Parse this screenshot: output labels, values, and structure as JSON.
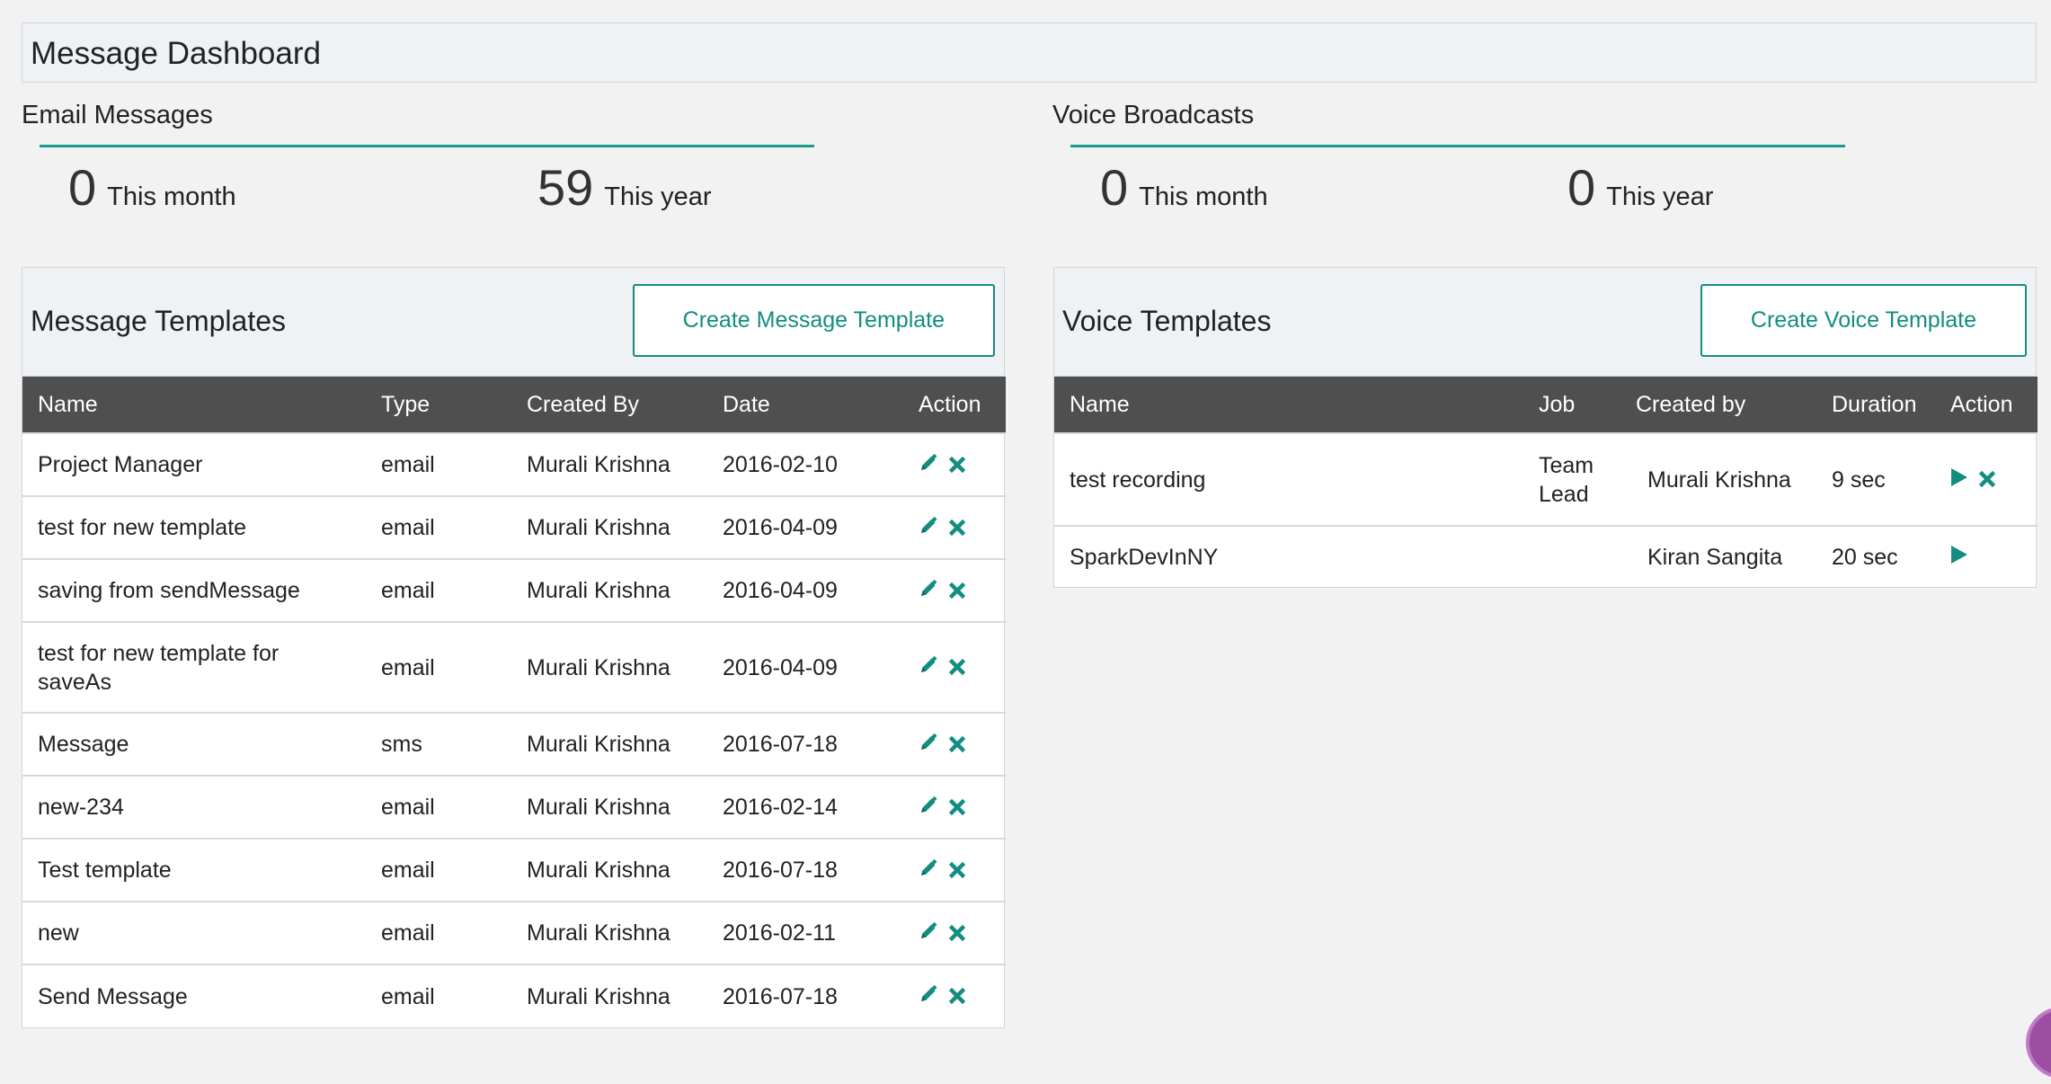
{
  "page": {
    "title": "Message Dashboard"
  },
  "email_stats": {
    "title": "Email Messages",
    "month": {
      "value": "0",
      "label": "This month"
    },
    "year": {
      "value": "59",
      "label": "This year"
    }
  },
  "voice_stats": {
    "title": "Voice Broadcasts",
    "month": {
      "value": "0",
      "label": "This month"
    },
    "year": {
      "value": "0",
      "label": "This year"
    }
  },
  "message_templates": {
    "title": "Message Templates",
    "create_label": "Create Message Template",
    "columns": [
      "Name",
      "Type",
      "Created By",
      "Date",
      "Action"
    ],
    "rows": [
      {
        "name": "Project Manager",
        "type": "email",
        "created_by": "Murali Krishna",
        "date": "2016-02-10"
      },
      {
        "name": "test for new template",
        "type": "email",
        "created_by": "Murali Krishna",
        "date": "2016-04-09"
      },
      {
        "name": "saving from sendMessage",
        "type": "email",
        "created_by": "Murali Krishna",
        "date": "2016-04-09"
      },
      {
        "name": "test for new template for saveAs",
        "type": "email",
        "created_by": "Murali Krishna",
        "date": "2016-04-09"
      },
      {
        "name": "Message",
        "type": "sms",
        "created_by": "Murali Krishna",
        "date": "2016-07-18"
      },
      {
        "name": "new-234",
        "type": "email",
        "created_by": "Murali Krishna",
        "date": "2016-02-14"
      },
      {
        "name": "Test template",
        "type": "email",
        "created_by": "Murali Krishna",
        "date": "2016-07-18"
      },
      {
        "name": "new",
        "type": "email",
        "created_by": "Murali Krishna",
        "date": "2016-02-11"
      },
      {
        "name": "Send Message",
        "type": "email",
        "created_by": "Murali Krishna",
        "date": "2016-07-18"
      }
    ]
  },
  "voice_templates": {
    "title": "Voice Templates",
    "create_label": "Create Voice Template",
    "columns": [
      "Name",
      "Job",
      "Created by",
      "Duration",
      "Action"
    ],
    "rows": [
      {
        "name": "test recording",
        "job": "Team Lead",
        "created_by": "Murali Krishna",
        "duration": "9 sec"
      },
      {
        "name": "SparkDevInNY",
        "job": "",
        "created_by": "Kiran Sangita",
        "duration": "20 sec"
      }
    ]
  },
  "colors": {
    "accent": "#138d80",
    "header_bg": "#4f4f4f",
    "panel_bg": "#eef2f5"
  },
  "icons": {
    "edit": "pencil-icon",
    "delete": "close-icon",
    "play": "play-icon"
  }
}
